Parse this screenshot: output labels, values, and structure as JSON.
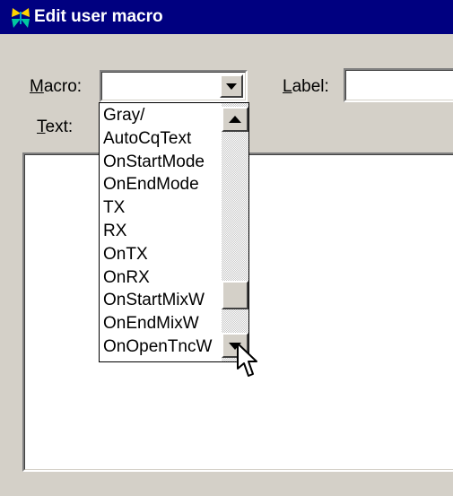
{
  "window": {
    "title": "Edit user macro",
    "icon": "butterfly-icon",
    "title_bar_color": "#000080"
  },
  "form": {
    "macro_label_accel": "M",
    "macro_label_rest": "acro:",
    "macro_value": "",
    "label_label_accel": "L",
    "label_label_rest": "abel:",
    "label_value": "",
    "text_label_accel": "T",
    "text_label_rest": "ext:",
    "text_value": ""
  },
  "dropdown": {
    "items": [
      "Gray/",
      "AutoCqText",
      "OnStartMode",
      "OnEndMode",
      "TX",
      "RX",
      "OnTX",
      "OnRX",
      "OnStartMixW",
      "OnEndMixW",
      "OnOpenTncW"
    ]
  }
}
